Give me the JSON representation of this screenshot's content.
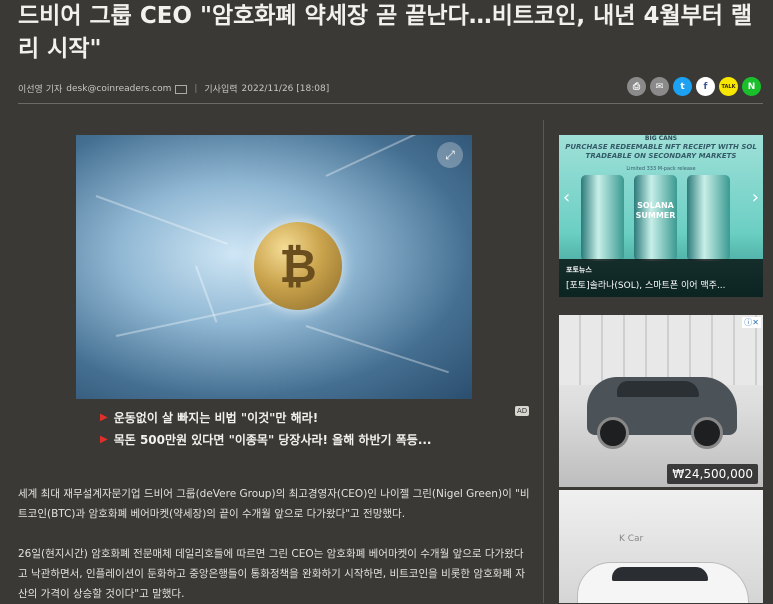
{
  "article": {
    "headline": "드비어 그룹 CEO \"암호화폐 약세장 곧 끝난다…비트코인, 내년 4월부터 랠리 시작\"",
    "author": "이선영 기자",
    "email": "desk@coinreaders.com",
    "published_label": "기사입력",
    "published": "2022/11/26 [18:08]",
    "paragraphs": [
      "세계 최대 재무설계자문기업 드비어 그룹(deVere Group)의 최고경영자(CEO)인 나이젤 그린(Nigel Green)이 \"비트코인(BTC)과 암호화폐 베어마켓(약세장)의 끝이 수개월 앞으로 다가왔다\"고 전망했다.",
      "26일(현지시간) 암호화폐 전문매체 데일리호들에 따르면 그린 CEO는 암호화폐 베어마켓이 수개월 앞으로 다가왔다고 낙관하면서, 인플레이션이 둔화하고 중앙은행들이 통화정책을 완화하기 시작하면, 비트코인을 비롯한 암호화폐 자산의 가격이 상승할 것이다\"고 말했다."
    ]
  },
  "share_icons": [
    {
      "name": "print-icon",
      "glyph": "⎙",
      "color": "#8a8a8a"
    },
    {
      "name": "email-icon",
      "glyph": "✉",
      "color": "#8a8a8a"
    },
    {
      "name": "twitter-icon",
      "glyph": "t",
      "color": "#1da1f2"
    },
    {
      "name": "facebook-icon",
      "glyph": "f",
      "color": "#3b5998"
    },
    {
      "name": "kakaotalk-icon",
      "glyph": "TALK",
      "color": "#f7e600"
    },
    {
      "name": "naver-icon",
      "glyph": "N",
      "color": "#19c02b"
    }
  ],
  "promos": [
    "운동없이 살 빠지는 비법 \"이것\"만 해라!",
    "목돈 500만원 있다면 \"이종목\" 당장사라! 올해 하반기 폭등..."
  ],
  "ad_badge": "AD",
  "sidebar": {
    "ad1": {
      "brand": "BIG CANS",
      "tagline": "PURCHASE REDEEMABLE NFT RECEIPT WITH SOL TRADEABLE ON SECONDARY MARKETS",
      "subtag": "Limited 333 M-pack release",
      "can_label": "SOLANA SUMMER",
      "category": "포토뉴스",
      "caption": "[포토]솔라나(SOL), 스마트폰 이어 맥주..."
    },
    "ad2": {
      "price": "₩24,500,000",
      "badge": "K Car"
    },
    "ad3": {
      "label": "K Car"
    }
  }
}
